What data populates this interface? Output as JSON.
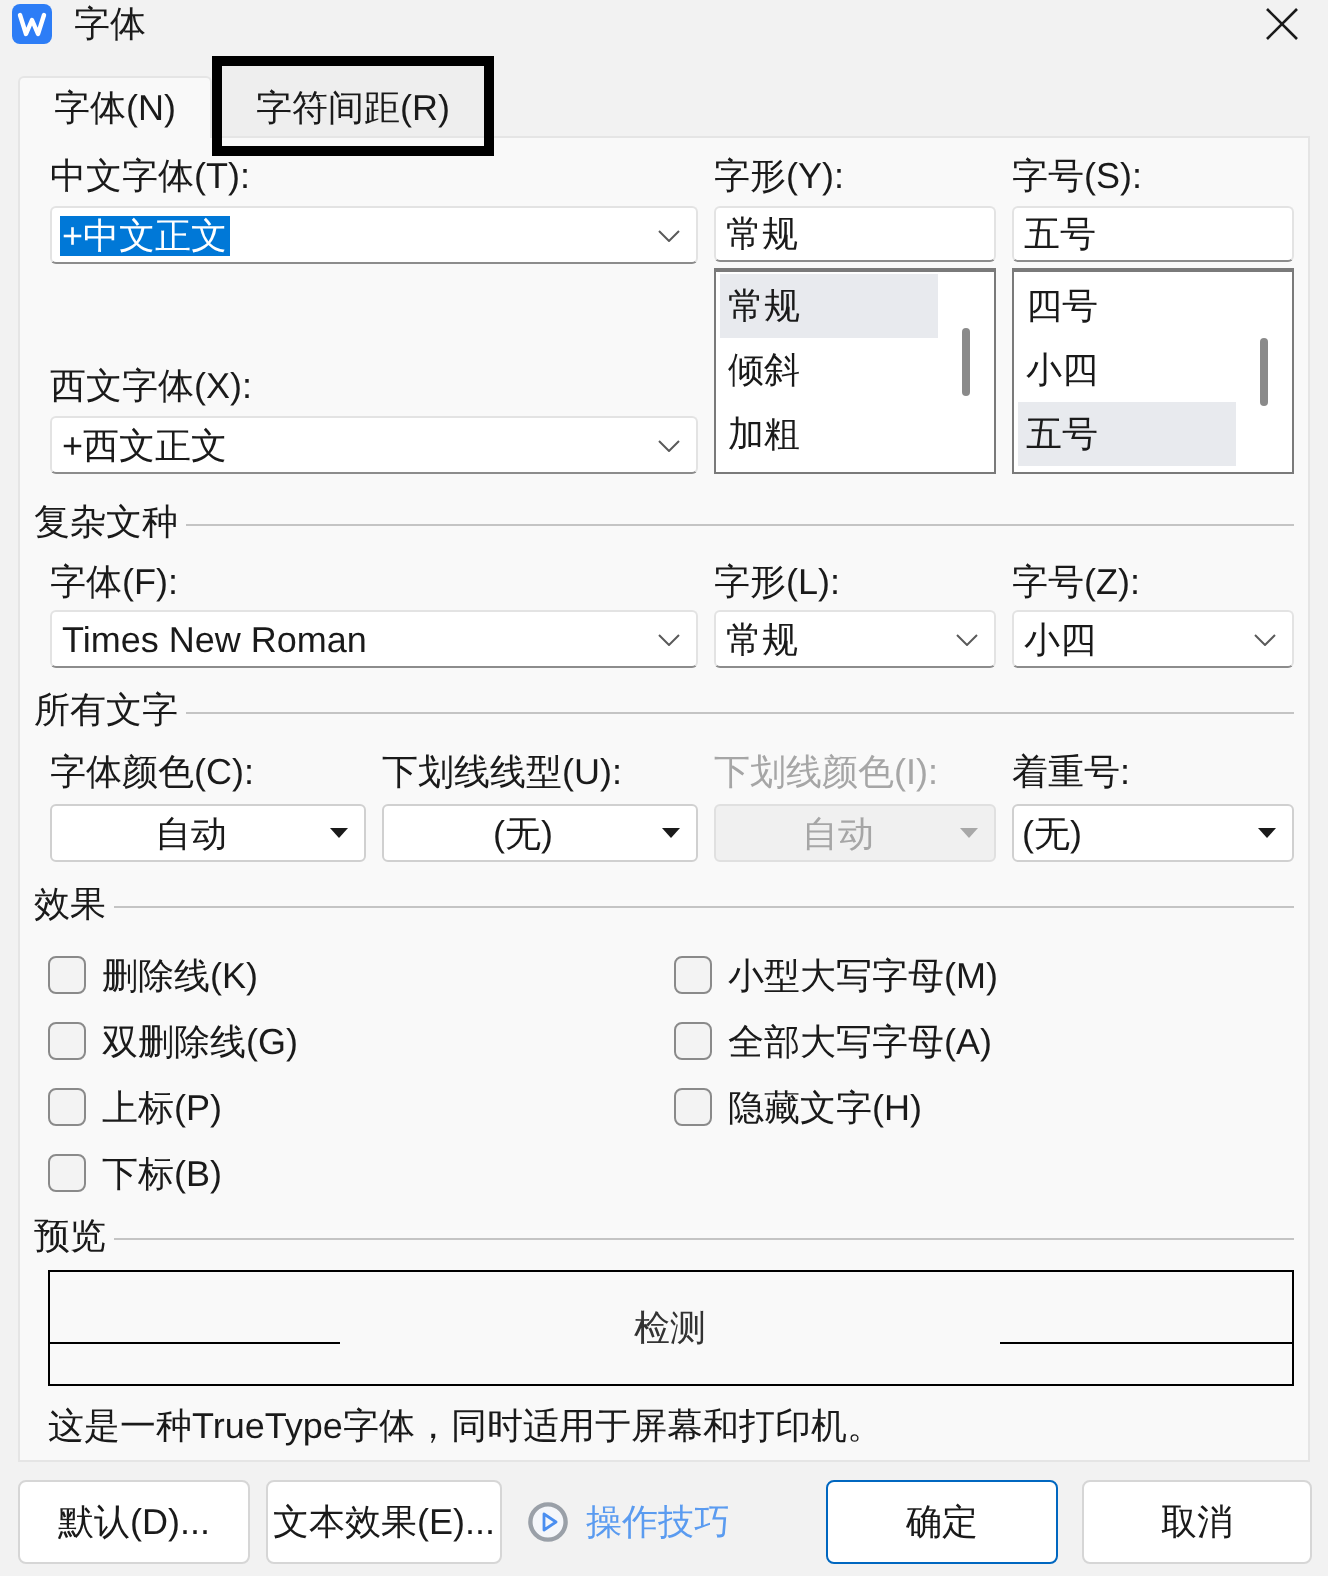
{
  "window": {
    "title": "字体"
  },
  "tabs": [
    {
      "label": "字体(N)",
      "selected": true,
      "outlined": false
    },
    {
      "label": "字符间距(R)",
      "selected": false,
      "outlined": true
    }
  ],
  "font": {
    "chinese_font": {
      "label": "中文字体(T):",
      "value": "+中文正文",
      "text_selected": true
    },
    "western_font": {
      "label": "西文字体(X):",
      "value": "+西文正文",
      "text_selected": false
    },
    "style": {
      "label": "字形(Y):",
      "value": "常规",
      "options": [
        {
          "label": "常规",
          "selected": true
        },
        {
          "label": "倾斜",
          "selected": false
        },
        {
          "label": "加粗",
          "selected": false
        }
      ]
    },
    "size": {
      "label": "字号(S):",
      "value": "五号",
      "options": [
        {
          "label": "四号",
          "selected": false
        },
        {
          "label": "小四",
          "selected": false
        },
        {
          "label": "五号",
          "selected": true
        }
      ]
    }
  },
  "complex_script": {
    "title": "复杂文种",
    "fields": [
      {
        "label": "字体(F):",
        "value": "Times New Roman"
      },
      {
        "label": "字形(L):",
        "value": "常规"
      },
      {
        "label": "字号(Z):",
        "value": "小四"
      }
    ]
  },
  "all_text": {
    "title": "所有文字",
    "fields": [
      {
        "label": "字体颜色(C):",
        "value": "自动",
        "disabled": false
      },
      {
        "label": "下划线线型(U):",
        "value": "(无)",
        "disabled": false
      },
      {
        "label": "下划线颜色(I):",
        "value": "自动",
        "disabled": true
      },
      {
        "label": "着重号:",
        "value": "(无)",
        "disabled": false
      }
    ]
  },
  "effects": {
    "title": "效果",
    "columns": [
      [
        {
          "label": "删除线(K)",
          "checked": false
        },
        {
          "label": "双删除线(G)",
          "checked": false
        },
        {
          "label": "上标(P)",
          "checked": false
        },
        {
          "label": "下标(B)",
          "checked": false
        }
      ],
      [
        {
          "label": "小型大写字母(M)",
          "checked": false
        },
        {
          "label": "全部大写字母(A)",
          "checked": false
        },
        {
          "label": "隐藏文字(H)",
          "checked": false
        }
      ]
    ]
  },
  "preview": {
    "title": "预览",
    "sample": "检测",
    "description": "这是一种TrueType字体，同时适用于屏幕和打印机。"
  },
  "buttons_left": [
    {
      "label": "默认(D)...",
      "focused": false
    },
    {
      "label": "文本效果(E)...",
      "focused": false
    }
  ],
  "tips_link": {
    "label": "操作技巧"
  },
  "buttons_right": [
    {
      "label": "确定",
      "focused": true
    },
    {
      "label": "取消",
      "focused": false
    }
  ]
}
